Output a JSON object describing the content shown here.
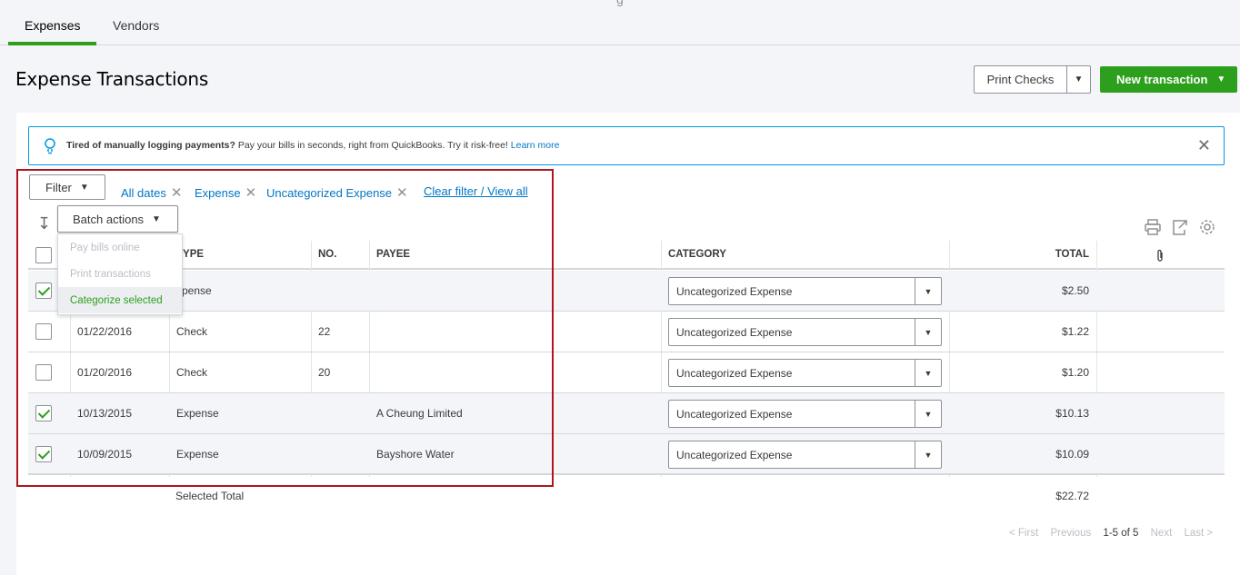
{
  "tabs": [
    {
      "label": "Expenses",
      "active": true
    },
    {
      "label": "Vendors",
      "active": false
    }
  ],
  "page_title": "Expense Transactions",
  "top_glyph": "g",
  "header_buttons": {
    "print_checks": "Print Checks",
    "new_transaction": "New transaction"
  },
  "banner": {
    "bold": "Tired of manually logging payments?",
    "text": " Pay your bills in seconds, right from QuickBooks. Try it risk-free! ",
    "link": "Learn more",
    "close": "✕"
  },
  "filter": {
    "button": "Filter",
    "chips": [
      "All dates",
      "Expense",
      "Uncategorized Expense"
    ],
    "clear": "Clear filter / View all"
  },
  "batch": {
    "button": "Batch actions",
    "menu": [
      {
        "label": "Pay bills online",
        "state": "disabled"
      },
      {
        "label": "Print transactions",
        "state": "disabled"
      },
      {
        "label": "Categorize selected",
        "state": "active"
      }
    ]
  },
  "table": {
    "headers": {
      "type": "TYPE",
      "no": "NO.",
      "payee": "PAYEE",
      "category": "CATEGORY",
      "total": "TOTAL"
    },
    "rows": [
      {
        "checked": true,
        "date": "",
        "type": "xpense",
        "no": "",
        "payee": "",
        "category": "Uncategorized Expense",
        "total": "$2.50"
      },
      {
        "checked": false,
        "date": "01/22/2016",
        "type": "Check",
        "no": "22",
        "payee": "",
        "category": "Uncategorized Expense",
        "total": "$1.22"
      },
      {
        "checked": false,
        "date": "01/20/2016",
        "type": "Check",
        "no": "20",
        "payee": "",
        "category": "Uncategorized Expense",
        "total": "$1.20"
      },
      {
        "checked": true,
        "date": "10/13/2015",
        "type": "Expense",
        "no": "",
        "payee": "A Cheung Limited",
        "category": "Uncategorized Expense",
        "total": "$10.13"
      },
      {
        "checked": true,
        "date": "10/09/2015",
        "type": "Expense",
        "no": "",
        "payee": "Bayshore Water",
        "category": "Uncategorized Expense",
        "total": "$10.09"
      }
    ],
    "footer_label": "Selected Total",
    "footer_total": "$22.72"
  },
  "pager": {
    "first": "< First",
    "previous": "Previous",
    "range": "1-5 of 5",
    "next": "Next",
    "last": "Last >"
  },
  "colors": {
    "accent": "#2ca01c",
    "link": "#0077c5",
    "highlight": "#b0151e"
  }
}
